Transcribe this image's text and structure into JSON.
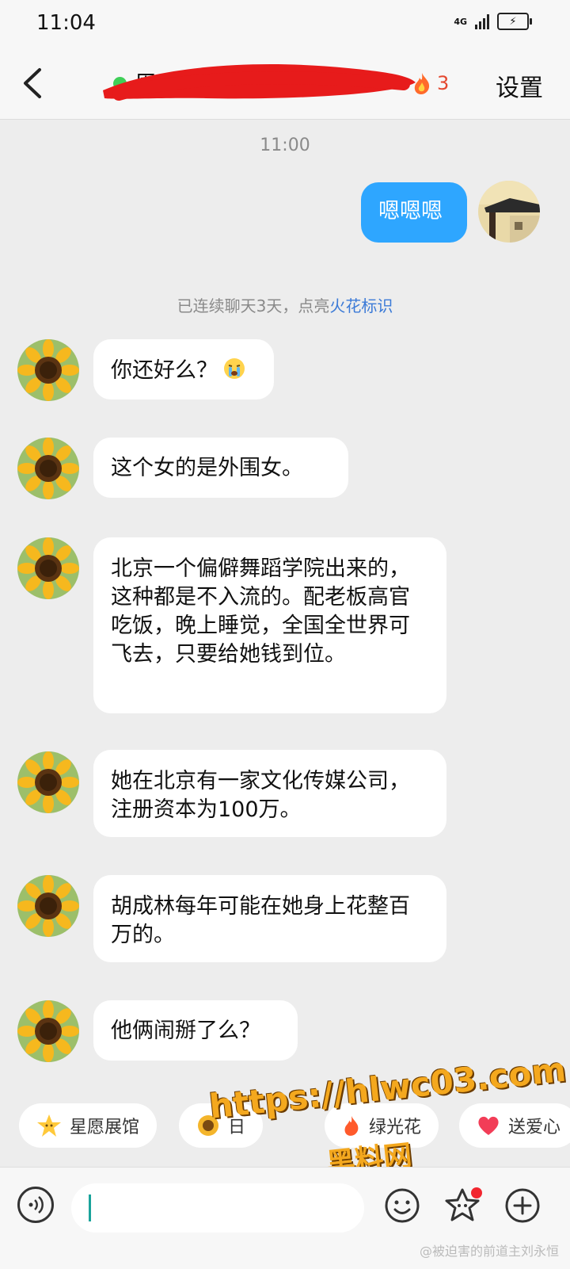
{
  "status_bar": {
    "time": "11:04",
    "network": "4G"
  },
  "header": {
    "back_icon": "chevron-left-icon",
    "contact_name": "周",
    "online": true,
    "streak_count": "3",
    "settings_label": "设置"
  },
  "chat": {
    "time_divider": "11:00",
    "outgoing": {
      "text": "嗯嗯嗯"
    },
    "system_note_prefix": "已连续聊天3天，点亮",
    "system_note_link": "火花标识",
    "incoming": [
      {
        "text": "你还好么？",
        "emoji": "crying-face-icon"
      },
      {
        "text": "这个女的是外围女。"
      },
      {
        "text": "北京一个偏僻舞蹈学院出来的，这种都是不入流的。配老板高官吃饭，晚上睡觉，全国全世界可飞去，只要给她钱到位。"
      },
      {
        "text": "她在北京有一家文化传媒公司，注册资本为100万。"
      },
      {
        "text": "胡成林每年可能在她身上花整百万的。"
      },
      {
        "text": "他俩闹掰了么？"
      }
    ]
  },
  "quick_bar": {
    "chips": [
      {
        "label": "星愿展馆",
        "icon": "star-face-icon"
      },
      {
        "label": "日",
        "icon": "sunflower-icon"
      },
      {
        "label": "绿光花",
        "icon": "flame-icon"
      },
      {
        "label": "送爱心",
        "icon": "heart-icon"
      }
    ]
  },
  "watermark": {
    "line1": "https://hlwc03.com",
    "line2": "黑料网"
  },
  "weibo_tag": "@被迫害的前道主刘永恒",
  "colors": {
    "accent_blue": "#2ea6ff",
    "streak_red": "#e4482f",
    "online_green": "#3fcf58"
  }
}
